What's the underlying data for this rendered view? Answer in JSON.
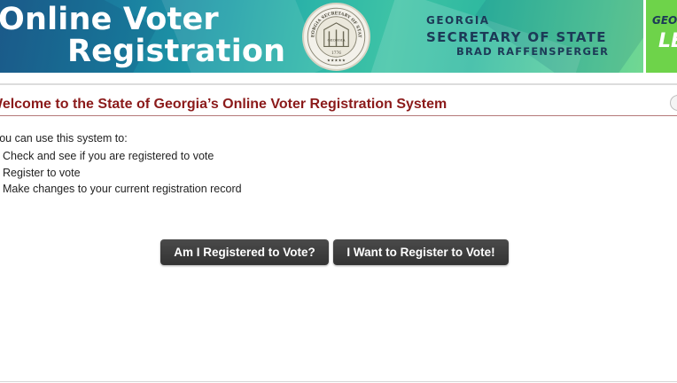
{
  "banner": {
    "title_line1": "Online Voter",
    "title_line2": "Registration",
    "seal_ring_text": "GEORGIA SECRETARY OF STATE",
    "seal_center_text": "GEORGIA",
    "seal_year": "1776",
    "state": "GEORGIA",
    "office": "SECRETARY OF STATE",
    "official_name": "BRAD RAFFENSPERGER",
    "badge_top": "GEORG",
    "badge_bottom": "LEA"
  },
  "main": {
    "heading": "Welcome to the State of Georgia’s Online Voter Registration System",
    "intro": "You can use this system to:",
    "options": [
      "Check and see if you are registered to vote",
      "Register to vote",
      "Make changes to your current registration record"
    ],
    "buttons": {
      "check_label": "Am I Registered to Vote?",
      "register_label": "I Want to Register to Vote!"
    }
  },
  "colors": {
    "heading": "#8b1a1a",
    "button": "#3a3a3a",
    "banner_teal": "#2db6a8",
    "badge_green": "#6ed34a"
  }
}
